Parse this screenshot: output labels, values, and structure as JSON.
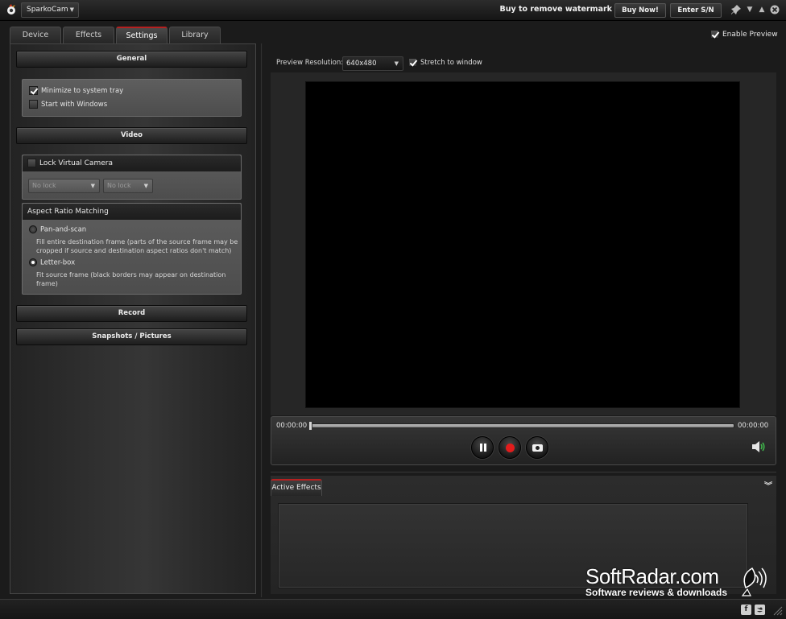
{
  "titlebar": {
    "app_name": "SparkoCam",
    "watermark_notice": "Buy to remove watermark",
    "buy_now_label": "Buy Now!",
    "enter_sn_label": "Enter S/N"
  },
  "tabs": [
    {
      "label": "Device",
      "active": false
    },
    {
      "label": "Effects",
      "active": false
    },
    {
      "label": "Settings",
      "active": true
    },
    {
      "label": "Library",
      "active": false
    }
  ],
  "enable_preview": {
    "label": "Enable Preview",
    "checked": true
  },
  "settings": {
    "general": {
      "header": "General",
      "minimize_tray": {
        "label": "Minimize to system tray",
        "checked": true
      },
      "start_windows": {
        "label": "Start with Windows",
        "checked": false
      }
    },
    "video": {
      "header": "Video",
      "lock_virtual_camera": {
        "label": "Lock Virtual Camera",
        "checked": false
      },
      "lock_select_1": "No lock",
      "lock_select_2": "No lock",
      "aspect_header": "Aspect Ratio Matching",
      "pan_and_scan": {
        "label": "Pan-and-scan",
        "selected": false,
        "desc_line1": "Fill entire destination frame (parts of the source frame may be",
        "desc_line2": "cropped if source and destination aspect ratios don't match)"
      },
      "letter_box": {
        "label": "Letter-box",
        "selected": true,
        "desc_line1": "Fit source frame (black borders may appear on destination",
        "desc_line2": "frame)"
      }
    },
    "record_header": "Record",
    "snapshots_header": "Snapshots / Pictures"
  },
  "preview": {
    "resolution_label": "Preview Resolution:",
    "resolution_value": "640x480",
    "stretch_label": "Stretch to window",
    "stretch_checked": true
  },
  "player": {
    "time_current": "00:00:00",
    "time_total": "00:00:00",
    "seek_progress": 0,
    "colors": {
      "record": "#e21c1c",
      "volume": "#3fb34a"
    }
  },
  "effects": {
    "tab_label": "Active Effects"
  },
  "watermark": {
    "title": "SoftRadar.com",
    "subtitle": "Software reviews & downloads"
  },
  "icons": {
    "app": "sparkocam-logo-icon",
    "pin": "pin-icon",
    "minimize": "minimize-icon",
    "restore": "restore-icon",
    "close": "close-icon",
    "volume": "volume-icon",
    "collapse": "double-chevron-down-icon",
    "facebook": "facebook-icon",
    "twitter": "twitter-icon",
    "grip": "resize-grip-icon",
    "satellite": "satellite-dish-icon"
  },
  "accent_color": "#b52020"
}
